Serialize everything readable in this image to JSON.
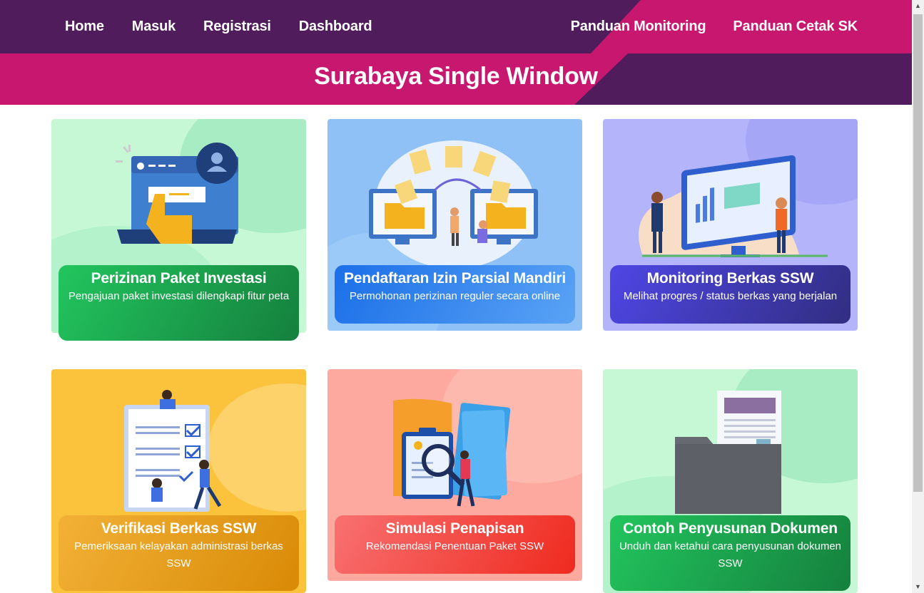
{
  "nav": {
    "left": [
      "Home",
      "Masuk",
      "Registrasi",
      "Dashboard"
    ],
    "right": [
      "Panduan Monitoring",
      "Panduan Cetak SK"
    ]
  },
  "site_title": "Surabaya Single Window",
  "cards": [
    {
      "title": "Perizinan Paket Investasi",
      "desc": "Pengajuan paket investasi dilengkapi fitur peta",
      "icon": "login-hand-illustration"
    },
    {
      "title": "Pendaftaran Izin Parsial Mandiri",
      "desc": "Permohonan perizinan reguler secara online",
      "icon": "file-transfer-illustration"
    },
    {
      "title": "Monitoring Berkas SSW",
      "desc": "Melihat progres / status berkas yang berjalan",
      "icon": "dashboard-monitor-illustration"
    },
    {
      "title": "Verifikasi Berkas SSW",
      "desc": "Pemeriksaan kelayakan administrasi berkas SSW",
      "icon": "checklist-illustration"
    },
    {
      "title": "Simulasi Penapisan",
      "desc": "Rekomendasi Penentuan Paket SSW",
      "icon": "clipboard-search-illustration"
    },
    {
      "title": "Contoh Penyusunan Dokumen",
      "desc": "Unduh dan ketahui cara penyusunan dokumen SSW",
      "icon": "folder-document-illustration"
    }
  ],
  "colors": {
    "header_purple": "#501c5c",
    "header_pink": "#c8176f"
  }
}
